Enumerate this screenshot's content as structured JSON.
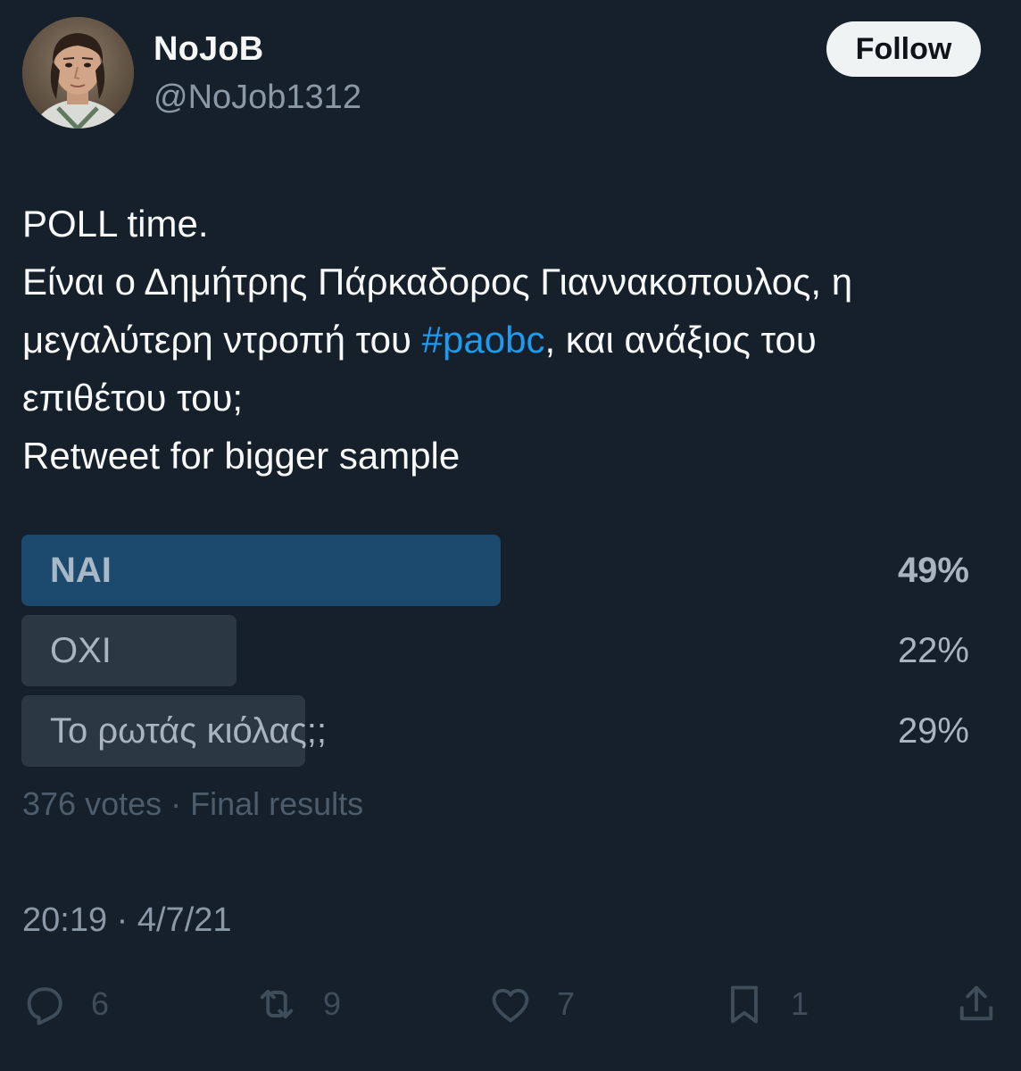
{
  "user": {
    "display_name": "NoJoB",
    "handle": "@NoJob1312",
    "follow_label": "Follow"
  },
  "tweet": {
    "line1": "POLL time.",
    "line2": "Είναι ο Δημήτρης Πάρκαδορος Γιαννακοπουλος, η",
    "line3_before": "μεγαλύτερη ντροπή του ",
    "hashtag": "#paobc",
    "line3_after": ", και ανάξιος του",
    "line4": "επιθέτου του;",
    "line5": "Retweet for bigger sample"
  },
  "poll": {
    "options": [
      {
        "label": "NAI",
        "percent_label": "49%",
        "percent": 49,
        "winner": true
      },
      {
        "label": "OXI",
        "percent_label": "22%",
        "percent": 22,
        "winner": false
      },
      {
        "label": "Το ρωτάς κιόλας;;",
        "percent_label": "29%",
        "percent": 29,
        "winner": false
      }
    ],
    "meta": "376 votes · Final results"
  },
  "timestamp": "20:19 · 4/7/21",
  "actions": {
    "replies": "6",
    "retweets": "9",
    "likes": "7",
    "bookmarks": "1"
  },
  "icons": [
    "reply-icon",
    "retweet-icon",
    "like-icon",
    "bookmark-icon",
    "share-icon"
  ],
  "colors": {
    "background": "#15202b",
    "hashtag": "#1d9bf0",
    "winner_bar": "#1b4a6e",
    "bar": "#2b3844"
  }
}
